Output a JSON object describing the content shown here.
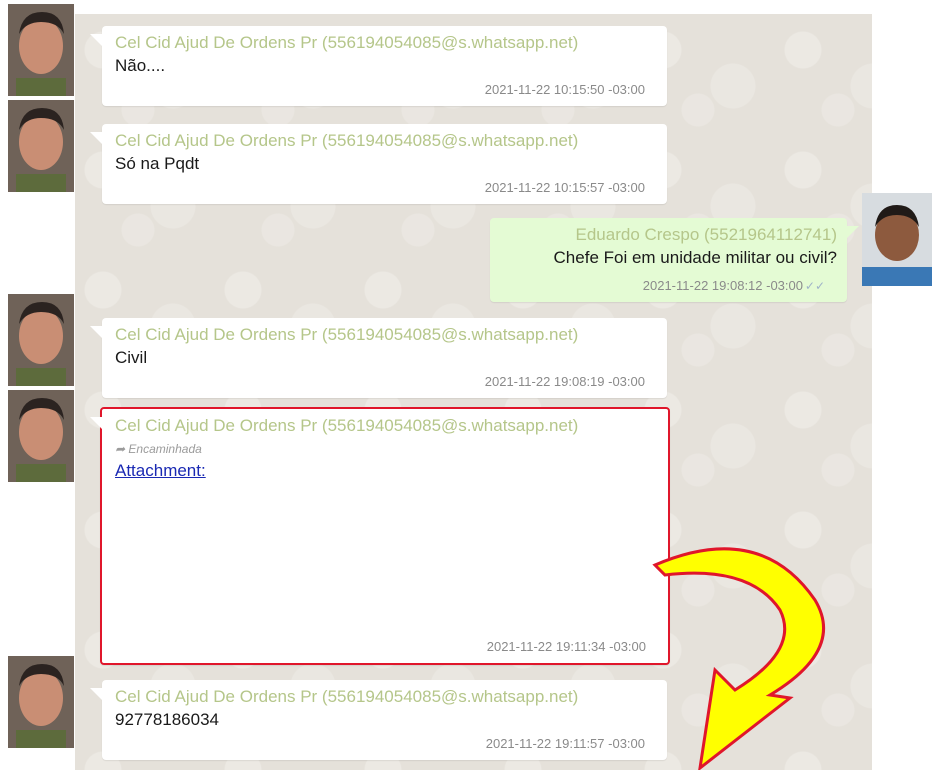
{
  "messages": [
    {
      "sender": "Cel Cid Ajud De Ordens Pr (556194054085@s.whatsapp.net)",
      "text": "Não....",
      "time": "2021-11-22 10:15:50 -03:00"
    },
    {
      "sender": "Cel Cid Ajud De Ordens Pr (556194054085@s.whatsapp.net)",
      "text": "Só na Pqdt",
      "time": "2021-11-22 10:15:57 -03:00"
    },
    {
      "sender": "Eduardo Crespo (5521964112741)",
      "text": "Chefe Foi em unidade militar ou civil?",
      "time": "2021-11-22 19:08:12 -03:00"
    },
    {
      "sender": "Cel Cid Ajud De Ordens Pr (556194054085@s.whatsapp.net)",
      "text": "Civil",
      "time": "2021-11-22 19:08:19 -03:00"
    },
    {
      "sender": "Cel Cid Ajud De Ordens Pr (556194054085@s.whatsapp.net)",
      "forwarded": "Encaminhada",
      "attachment": "Attachment:",
      "time": "2021-11-22 19:11:34 -03:00"
    },
    {
      "sender": "Cel Cid Ajud De Ordens Pr (556194054085@s.whatsapp.net)",
      "text": "92778186034",
      "time": "2021-11-22 19:11:57 -03:00"
    }
  ],
  "icons": {
    "forward": "forward-arrow-icon",
    "read_receipt": "double-check-icon",
    "annotation": "curved-yellow-arrow"
  },
  "colors": {
    "sender": "#b5c68a",
    "outgoing_bubble": "#e4fbd4",
    "highlight_border": "#e0162b",
    "arrow_fill": "#ffff00"
  }
}
